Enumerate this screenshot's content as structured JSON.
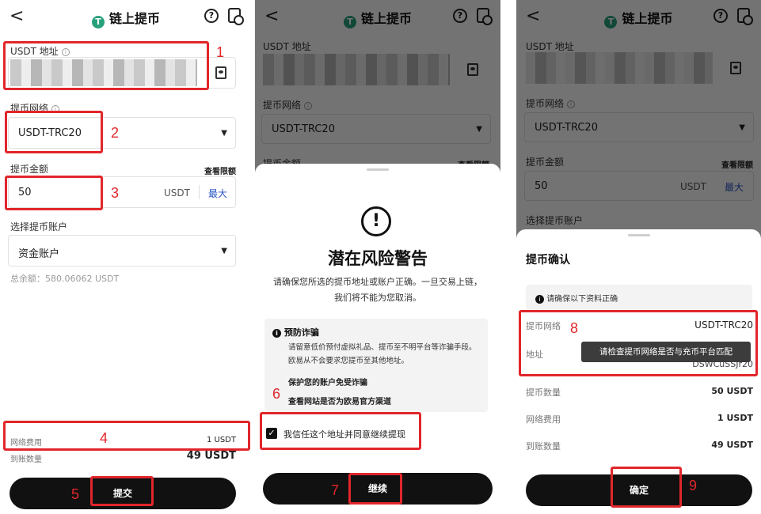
{
  "header": {
    "back_glyph": "<",
    "title": "链上提币",
    "logo_letter": "T",
    "help_glyph": "?"
  },
  "form": {
    "address_label": "USDT 地址",
    "network_label": "提币网络",
    "network_value": "USDT-TRC20",
    "amount_label": "提币金额",
    "view_limit": "查看限额",
    "amount_value": "50",
    "amount_unit": "USDT",
    "max_label": "最大",
    "account_label": "选择提币账户",
    "account_value": "资金账户",
    "total_balance": "总余额：580.06062 USDT",
    "fee_label": "网络费用",
    "fee_value": "1 USDT",
    "receive_label": "到账数量",
    "receive_value": "49 USDT",
    "submit_label": "提交"
  },
  "warning_sheet": {
    "icon_glyph": "!",
    "title": "潜在风险警告",
    "description": "请确保您所选的提币地址或账户正确。一旦交易上链，我们将不能为您取消。",
    "fraud_title": "预防诈骗",
    "fraud_text": "请留意低价预付虚拟礼品、提币至不明平台等诈骗手段。欧易从不会要求您提币至其他地址。",
    "protect_label": "保护您的账户免受诈骗",
    "check_site_label": "查看网站是否为欧易官方渠道",
    "trust_checkbox_label": "我信任这个地址并同意继续提现",
    "trust_checked": true,
    "continue_label": "继续"
  },
  "confirm_sheet": {
    "title": "提币确认",
    "notice": "请确保以下资料正确",
    "network_label": "提币网络",
    "network_value": "USDT-TRC20",
    "address_label": "地址",
    "address_partial": "DSWCuSSJr20",
    "tooltip": "请检查提币网络是否与充币平台匹配",
    "amount_label": "提币数量",
    "amount_value": "50 USDT",
    "fee_label": "网络费用",
    "fee_value": "1 USDT",
    "receive_label": "到账数量",
    "receive_value": "49 USDT",
    "confirm_label": "确定"
  },
  "step_numbers": [
    "1",
    "2",
    "3",
    "4",
    "5",
    "6",
    "7",
    "8",
    "9"
  ],
  "colors": {
    "annotation_red": "#e1262b",
    "tether_green": "#27a17c",
    "link_blue": "#2a56c6",
    "button_black": "#111111",
    "dim_overlay": "rgba(0,0,0,0.55)"
  }
}
